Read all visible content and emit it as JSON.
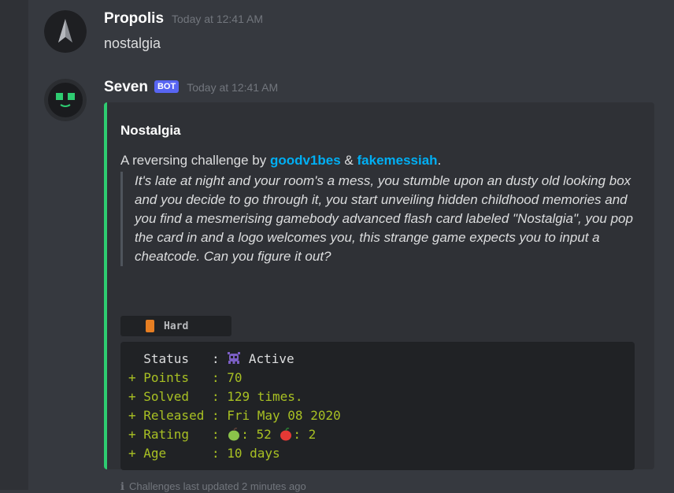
{
  "messages": [
    {
      "username": "Propolis",
      "timestamp": "Today at 12:41 AM",
      "content": "nostalgia"
    },
    {
      "username": "Seven",
      "bot_tag": "BOT",
      "timestamp": "Today at 12:41 AM"
    }
  ],
  "embed": {
    "accent_color": "#2ecc71",
    "title": "Nostalgia",
    "desc_prefix": "A reversing challenge by ",
    "author1": "goodv1bes",
    "desc_amp": " & ",
    "author2": "fakemessiah",
    "desc_suffix": ".",
    "quote": "It's late at night and your room's a mess, you stumble upon an dusty old looking box and you decide to go through it, you start unveiling hidden childhood memories and you find a mesmerising gamebody advanced flash card labeled \"Nostalgia\", you pop the card in and a logo welcomes you, this strange game expects you to input a cheatcode. Can you figure it out?",
    "difficulty": "Hard",
    "difficulty_icon": "orange-book-icon",
    "stats": [
      {
        "prefix": "  ",
        "label": "Status   : ",
        "icon": "alien-monster-icon",
        "value": " Active",
        "style": "plain"
      },
      {
        "prefix": "+ ",
        "label": "Points   : ",
        "value": "70",
        "style": "diff"
      },
      {
        "prefix": "+ ",
        "label": "Solved   : ",
        "value": "129 times.",
        "style": "diff"
      },
      {
        "prefix": "+ ",
        "label": "Released : ",
        "value": "Fri May 08 2020",
        "style": "diff"
      },
      {
        "prefix": "+ ",
        "label": "Rating   : ",
        "icon": "green-apple-icon",
        "value": ": 52 ",
        "icon2": "red-apple-icon",
        "value2": ": 2",
        "style": "diff"
      },
      {
        "prefix": "+ ",
        "label": "Age      : ",
        "value": "10 days",
        "style": "diff"
      }
    ],
    "footer": "Challenges last updated 2 minutes ago",
    "footer_icon": "info-icon"
  },
  "colors": {
    "background": "#36393f",
    "embed_bg": "#2f3136",
    "link": "#00aff4",
    "bot_tag": "#5865f2",
    "diff_green": "#a8c023"
  }
}
